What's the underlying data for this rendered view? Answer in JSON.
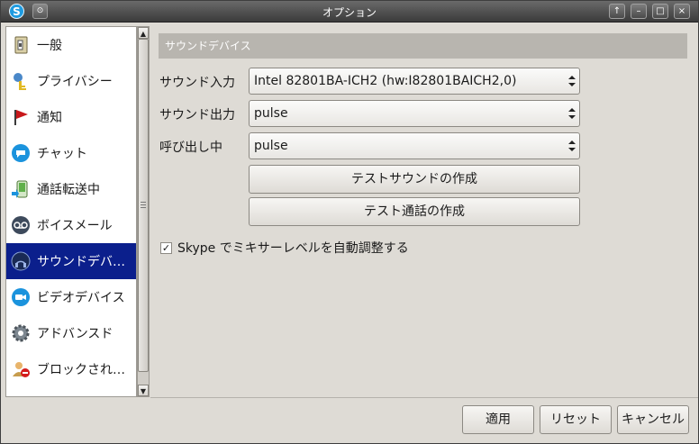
{
  "window": {
    "title": "オプション"
  },
  "titlebar": {
    "app_icon": "S",
    "pin_glyph": "⊙",
    "buttons": [
      "↑",
      "–",
      "□",
      "×"
    ]
  },
  "sidebar": {
    "items": [
      {
        "label": "一般",
        "icon": "general-icon"
      },
      {
        "label": "プライバシー",
        "icon": "privacy-icon"
      },
      {
        "label": "通知",
        "icon": "notification-flag-icon"
      },
      {
        "label": "チャット",
        "icon": "chat-icon"
      },
      {
        "label": "通話転送中",
        "icon": "call-forward-icon"
      },
      {
        "label": "ボイスメール",
        "icon": "voicemail-icon"
      },
      {
        "label": "サウンドデバイス",
        "icon": "sound-device-icon",
        "selected": true
      },
      {
        "label": "ビデオデバイス",
        "icon": "video-device-icon"
      },
      {
        "label": "アドバンスド",
        "icon": "advanced-gear-icon"
      },
      {
        "label": "ブロックされたユーザー",
        "icon": "blocked-user-icon"
      },
      {
        "label": "",
        "icon": "next-arrow-icon"
      }
    ]
  },
  "main": {
    "section_title": "サウンドデバイス",
    "fields": [
      {
        "label": "サウンド入力",
        "value": "Intel 82801BA-ICH2 (hw:I82801BAICH2,0)"
      },
      {
        "label": "サウンド出力",
        "value": "pulse"
      },
      {
        "label": "呼び出し中",
        "value": "pulse"
      }
    ],
    "test_sound_button": "テストサウンドの作成",
    "test_call_button": "テスト通話の作成",
    "auto_adjust_checkbox": {
      "label": "Skype でミキサーレベルを自動調整する",
      "checked": true,
      "mark": "✓"
    }
  },
  "footer": {
    "apply": "適用",
    "reset": "リセット",
    "cancel": "キャンセル"
  },
  "scrollbar": {
    "up": "▲",
    "down": "▼"
  }
}
